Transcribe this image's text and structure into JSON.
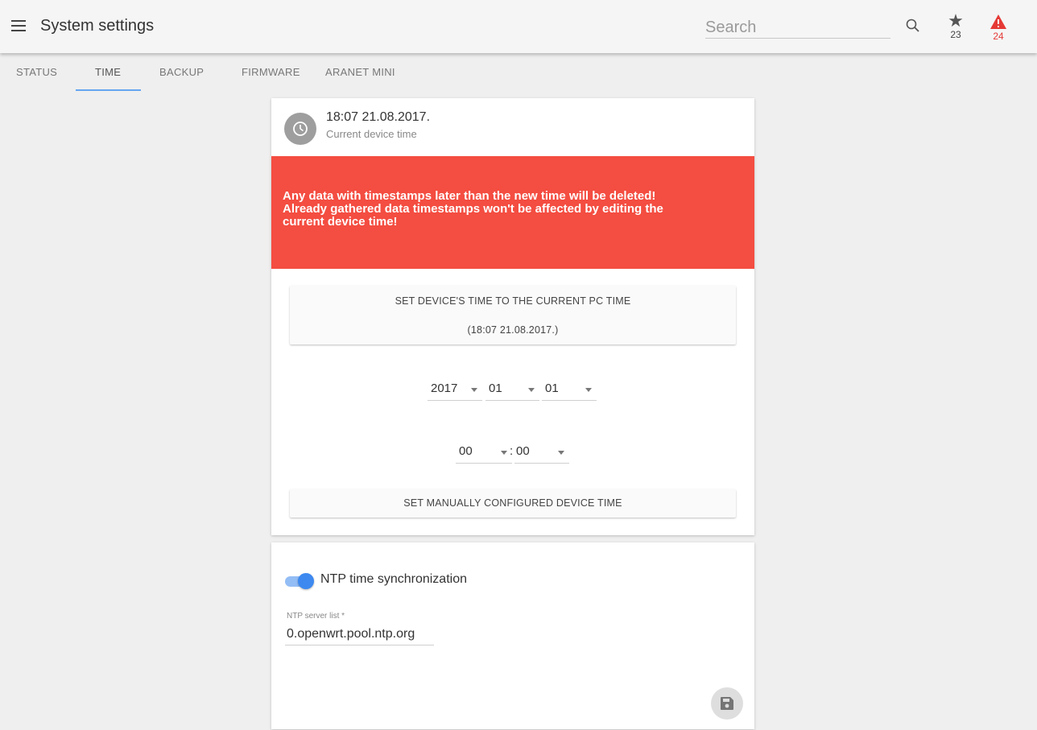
{
  "app": {
    "title": "System settings",
    "search_placeholder": "Search",
    "favorites_count": "23",
    "alerts_count": "24",
    "accent_color": "#64a6f0",
    "alert_color": "#e53935"
  },
  "tabs": [
    {
      "label": "STATUS",
      "active": false
    },
    {
      "label": "TIME",
      "active": true
    },
    {
      "label": "BACKUP",
      "active": false
    },
    {
      "label": "FIRMWARE",
      "active": false
    },
    {
      "label": "ARANET MINI",
      "active": false
    }
  ],
  "time_card": {
    "current_time": "18:07 21.08.2017.",
    "current_time_label": "Current device time",
    "warning_text": "Any data with timestamps later than the new time will be deleted!\nAlready gathered data timestamps won't be affected by editing the\ncurrent device time!",
    "warning_color": "#f44d41",
    "set_pc_button_label": "SET DEVICE'S TIME TO THE CURRENT PC TIME",
    "set_pc_button_time": "(18:07 21.08.2017.)",
    "year": "2017",
    "month": "01",
    "day": "01",
    "hour": "00",
    "time_separator": ":",
    "minute": "00",
    "manual_button_label": "SET MANUALLY CONFIGURED DEVICE TIME"
  },
  "ntp_card": {
    "toggle_label": "NTP time synchronization",
    "toggle_on": true,
    "server_list_label": "NTP server list *",
    "server_list_value": "0.openwrt.pool.ntp.org"
  },
  "icons": [
    "menu-icon",
    "search-icon",
    "star-icon",
    "warning-icon",
    "clock-icon",
    "save-icon"
  ]
}
